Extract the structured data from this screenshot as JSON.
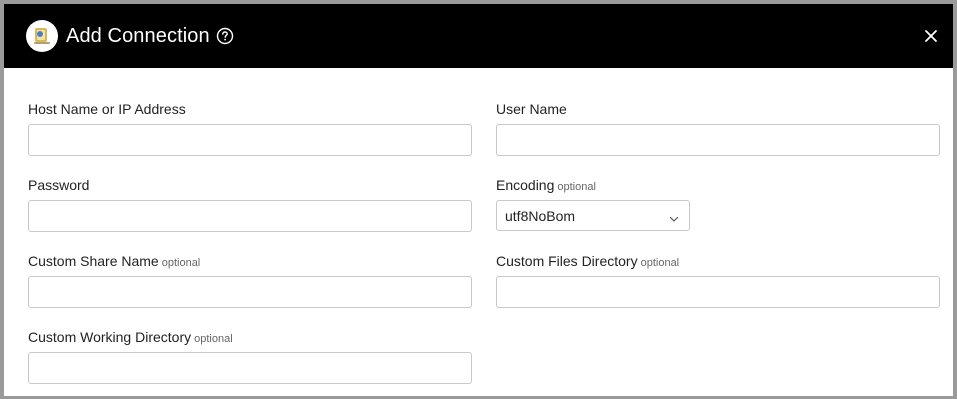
{
  "dialog": {
    "title": "Add Connection",
    "icons": {
      "logo": "app-logo-icon",
      "help": "help-circle-icon",
      "close": "close-icon"
    }
  },
  "form": {
    "host": {
      "label": "Host Name or IP Address",
      "value": ""
    },
    "user": {
      "label": "User Name",
      "value": ""
    },
    "password": {
      "label": "Password",
      "value": ""
    },
    "encoding": {
      "label": "Encoding",
      "optional": "optional",
      "value": "utf8NoBom"
    },
    "share": {
      "label": "Custom Share Name",
      "optional": "optional",
      "value": ""
    },
    "files_dir": {
      "label": "Custom Files Directory",
      "optional": "optional",
      "value": ""
    },
    "working_dir": {
      "label": "Custom Working Directory",
      "optional": "optional",
      "value": ""
    }
  },
  "colors": {
    "header_bg": "#000000",
    "border": "#c9c9c9"
  }
}
